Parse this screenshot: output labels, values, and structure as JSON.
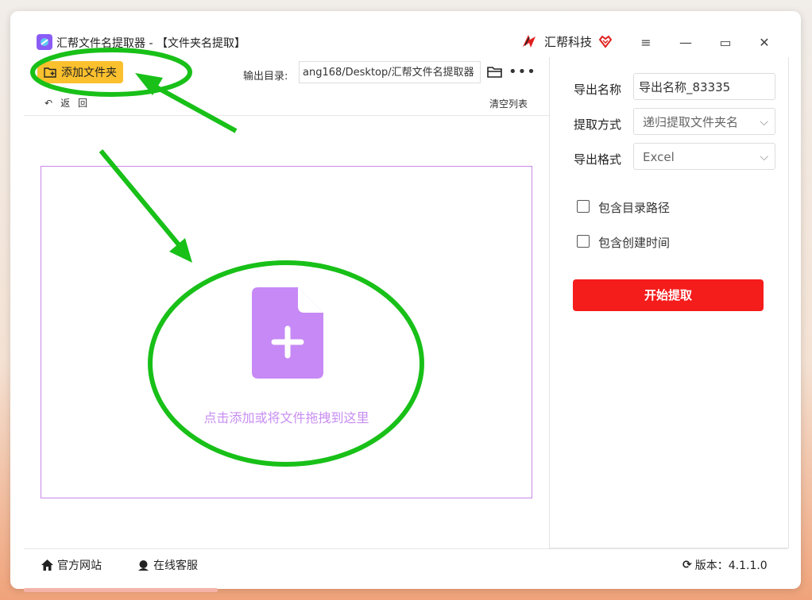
{
  "window": {
    "title": "汇帮文件名提取器 - 【文件夹名提取】",
    "brand": "汇帮科技",
    "controls": [
      "≡",
      "—",
      "▭",
      "✕"
    ]
  },
  "toolbar": {
    "add_folder_label": "添加文件夹",
    "output_dir_label": "输出目录:",
    "output_dir_value": "ang168/Desktop/汇帮文件名提取器",
    "more": "•••",
    "back_label": "返",
    "back_label2": "回",
    "clear_list_label": "清空列表"
  },
  "dropzone": {
    "hint": "点击添加或将文件拖拽到这里"
  },
  "panel": {
    "export_name_label": "导出名称",
    "export_name_value": "导出名称_83335",
    "method_label": "提取方式",
    "method_value": "递归提取文件夹名",
    "format_label": "导出格式",
    "format_value": "Excel",
    "opt_path_label": "包含目录路径",
    "opt_path_checked": false,
    "opt_time_label": "包含创建时间",
    "opt_time_checked": false,
    "start_label": "开始提取"
  },
  "footer": {
    "website_label": "官方网站",
    "support_label": "在线客服",
    "version_label": "版本：4.1.1.0"
  },
  "colors": {
    "accent_yellow": "#fbc02d",
    "start_red": "#f51c1c",
    "dropzone_purple": "#c888e8",
    "annotation_green": "#18c018"
  }
}
